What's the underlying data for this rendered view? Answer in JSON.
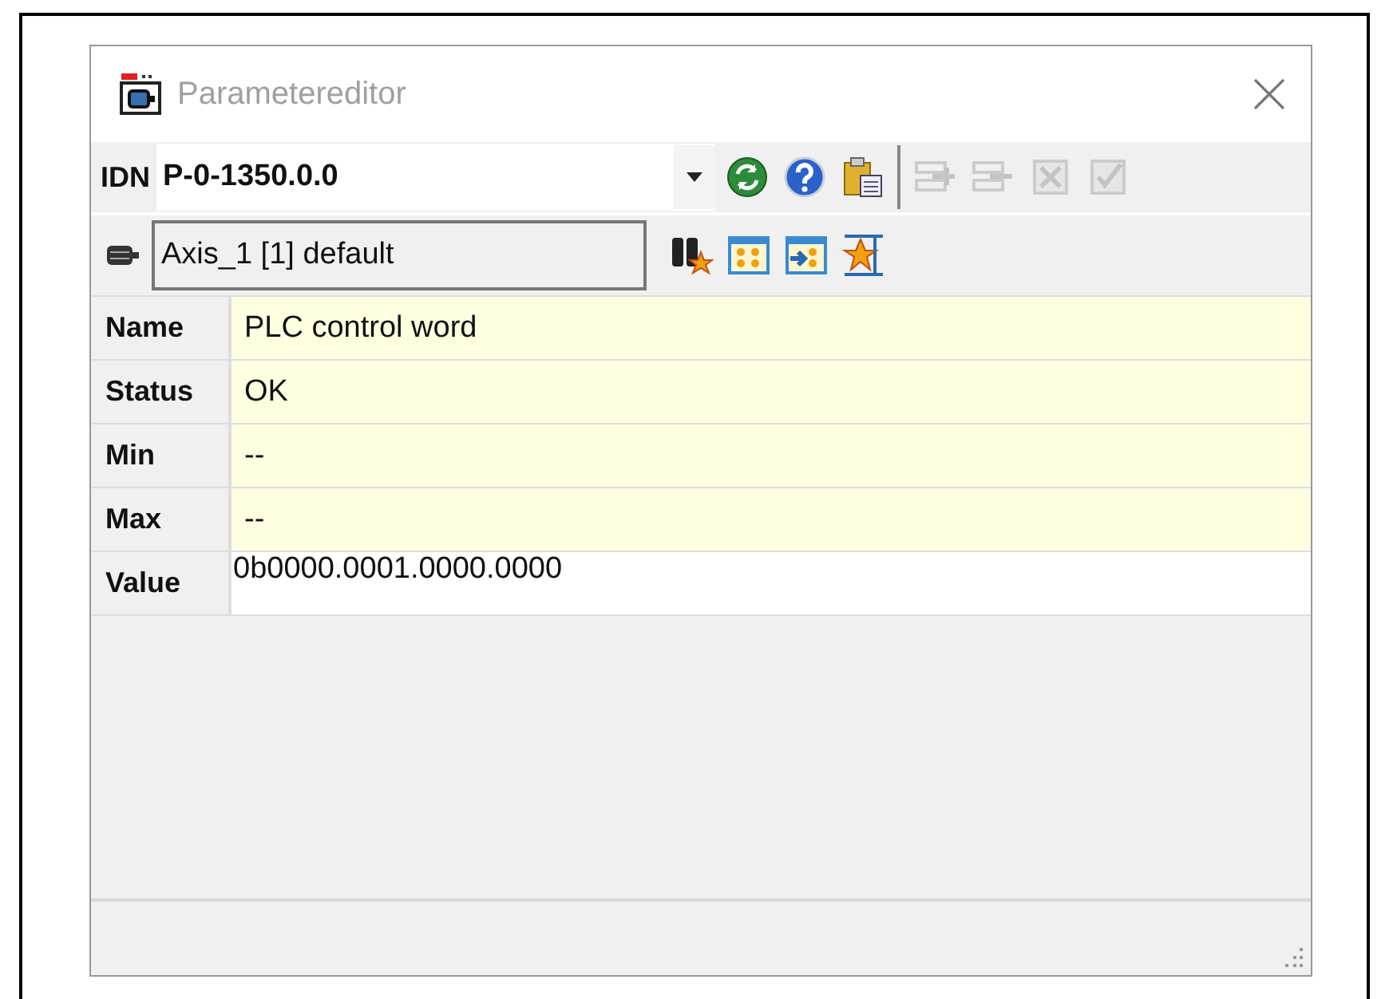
{
  "window": {
    "title": "Parametereditor"
  },
  "idn": {
    "label": "IDN",
    "value": "P-0-1350.0.0"
  },
  "toolbar": [
    {
      "kind": "refresh",
      "disabled": false
    },
    {
      "kind": "help",
      "disabled": false
    },
    {
      "kind": "clipboard",
      "disabled": false
    }
  ],
  "edit_tools": [
    {
      "kind": "insert",
      "disabled": true
    },
    {
      "kind": "remove",
      "disabled": true
    },
    {
      "kind": "cross",
      "disabled": true
    },
    {
      "kind": "check",
      "disabled": true
    }
  ],
  "axis": {
    "value": "Axis_1 [1] default"
  },
  "axis_tools": [
    {
      "kind": "find-star"
    },
    {
      "kind": "star-grid"
    },
    {
      "kind": "arrow-star"
    },
    {
      "kind": "star-arrows"
    }
  ],
  "rows": [
    {
      "label": "Name",
      "value": "PLC control word",
      "editable": false
    },
    {
      "label": "Status",
      "value": "OK",
      "editable": false
    },
    {
      "label": "Min",
      "value": "--",
      "editable": false
    },
    {
      "label": "Max",
      "value": "--",
      "editable": false
    },
    {
      "label": "Value",
      "value": "0b0000.0001.0000.0000",
      "editable": true
    }
  ]
}
